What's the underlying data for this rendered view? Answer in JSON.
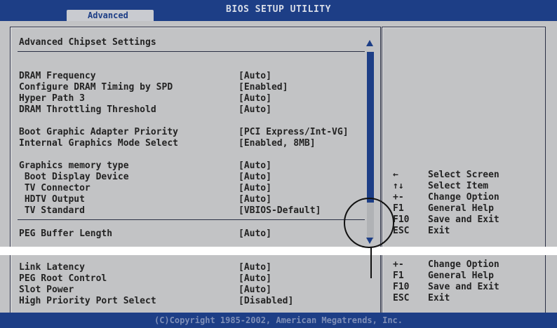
{
  "header": {
    "title": "BIOS SETUP UTILITY",
    "active_tab": "Advanced"
  },
  "section": {
    "title": "Advanced Chipset Settings"
  },
  "settings_top": [
    {
      "label": "DRAM Frequency",
      "value": "[Auto]"
    },
    {
      "label": "Configure DRAM Timing by SPD",
      "value": "[Enabled]"
    },
    {
      "label": "Hyper Path 3",
      "value": "[Auto]"
    },
    {
      "label": "DRAM Throttling Threshold",
      "value": "[Auto]"
    },
    {
      "label": "Boot Graphic Adapter Priority",
      "value": "[PCI Express/Int-VG]"
    },
    {
      "label": "Internal Graphics Mode Select",
      "value": "[Enabled, 8MB]"
    },
    {
      "label": "Graphics memory type",
      "value": "[Auto]"
    },
    {
      "label": " Boot Display Device",
      "value": "[Auto]"
    },
    {
      "label": " TV Connector",
      "value": "[Auto]"
    },
    {
      "label": " HDTV Output",
      "value": "[Auto]"
    },
    {
      "label": " TV Standard",
      "value": "[VBIOS-Default]"
    },
    {
      "label": "PEG Buffer Length",
      "value": "[Auto]"
    }
  ],
  "settings_bottom": [
    {
      "label": "Link Latency",
      "value": "[Auto]"
    },
    {
      "label": "PEG Root Control",
      "value": "[Auto]"
    },
    {
      "label": "Slot Power",
      "value": "[Auto]"
    },
    {
      "label": "High Priority Port Select",
      "value": "[Disabled]"
    }
  ],
  "help_top": [
    {
      "key": "←",
      "desc": "Select Screen"
    },
    {
      "key": "↑↓",
      "desc": "Select Item"
    },
    {
      "key": "+-",
      "desc": "Change Option"
    },
    {
      "key": "F1",
      "desc": "General Help"
    },
    {
      "key": "F10",
      "desc": "Save and Exit"
    },
    {
      "key": "ESC",
      "desc": "Exit"
    }
  ],
  "help_bottom": [
    {
      "key": "+-",
      "desc": "Change Option"
    },
    {
      "key": "F1",
      "desc": "General Help"
    },
    {
      "key": "F10",
      "desc": "Save and Exit"
    },
    {
      "key": "ESC",
      "desc": "Exit"
    }
  ],
  "footer": {
    "copyright": "(C)Copyright 1985-2002, American Megatrends, Inc."
  },
  "colors": {
    "bar": "#1d3e86",
    "panel": "#c2c3c5",
    "text": "#232323"
  }
}
